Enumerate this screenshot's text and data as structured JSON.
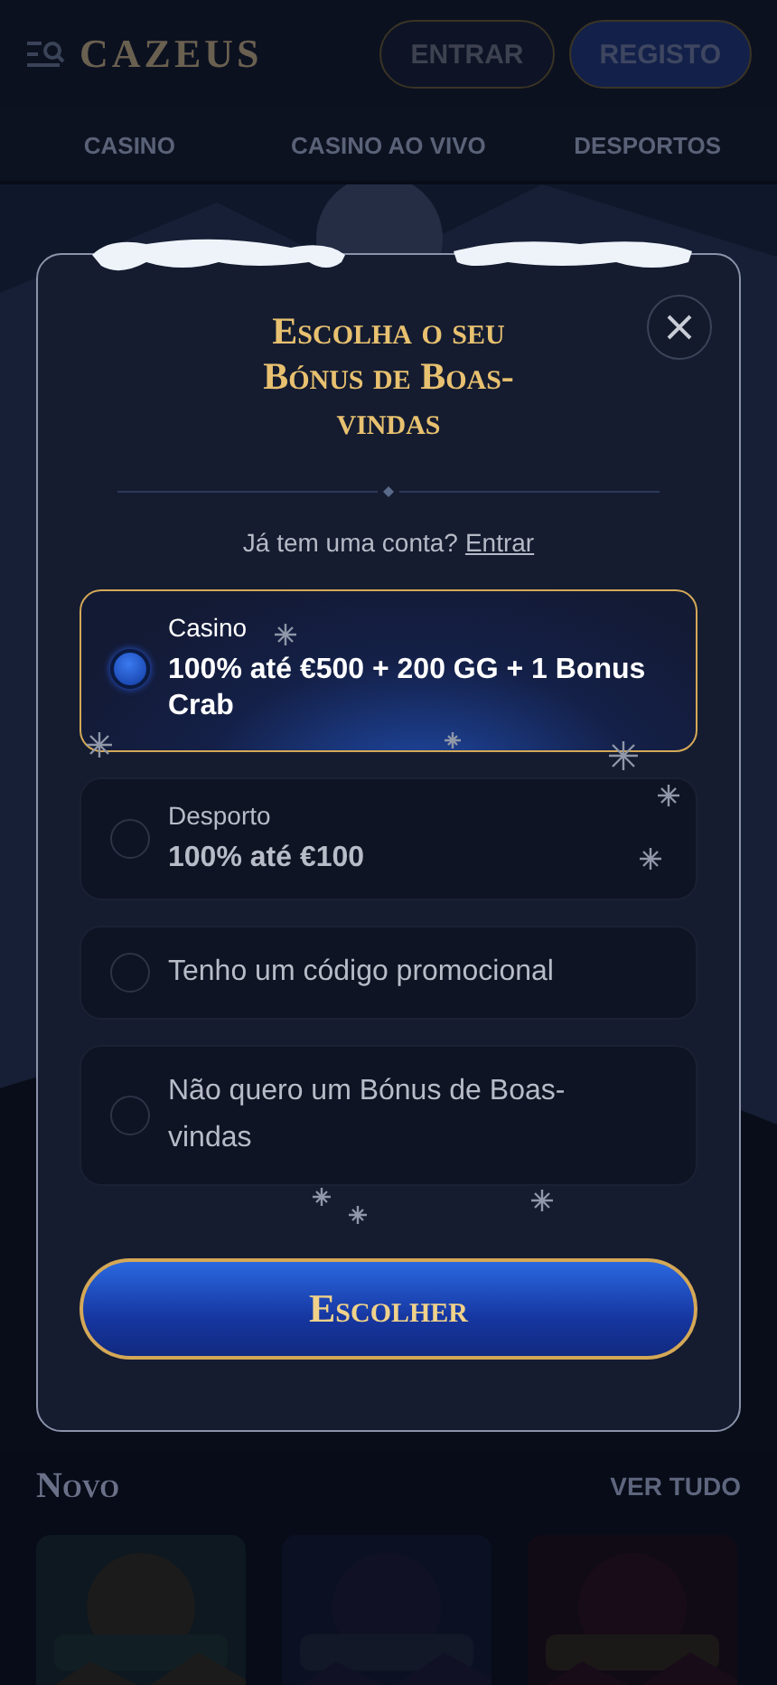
{
  "header": {
    "logo": "CAZEUS",
    "buttons": [
      {
        "label": "ENTRAR",
        "kind": "outline"
      },
      {
        "label": "REGISTO",
        "kind": "primary"
      }
    ]
  },
  "nav": [
    "CASINO",
    "CASINO AO VIVO",
    "DESPORTOS"
  ],
  "modal": {
    "title": "Escolha o seu Bónus de Boas-vindas",
    "login_prompt": "Já tem uma conta?",
    "login_link": "Entrar",
    "options": [
      {
        "kind": "offer",
        "label": "Casino",
        "value": "100% até €500 + 200 GG + 1 Bonus Crab",
        "selected": true
      },
      {
        "kind": "offer",
        "label": "Desporto",
        "value": "100% até €100",
        "selected": false
      },
      {
        "kind": "plain",
        "value": "Tenho um código promocional",
        "selected": false
      },
      {
        "kind": "plain",
        "value": "Não quero um Bónus de Boas-vindas",
        "selected": false
      }
    ],
    "button": "Escolher"
  },
  "section": {
    "title": "Novo",
    "link": "VER TUDO"
  }
}
